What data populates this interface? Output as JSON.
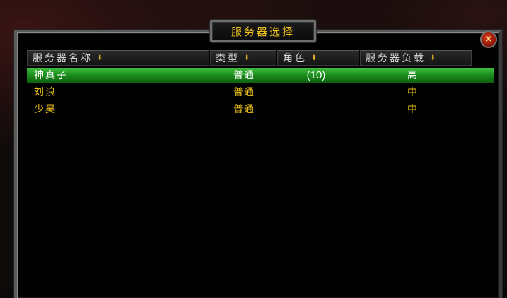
{
  "dialog": {
    "title": "服务器选择",
    "close_label": "✕"
  },
  "columns": [
    {
      "label": "服务器名称",
      "sort_icon": "sort-down-arrow-icon"
    },
    {
      "label": "类型",
      "sort_icon": "sort-down-arrow-icon"
    },
    {
      "label": "角色",
      "sort_icon": "sort-down-arrow-icon"
    },
    {
      "label": "服务器负载",
      "sort_icon": "sort-down-arrow-icon"
    }
  ],
  "servers": [
    {
      "name": "神真子",
      "type": "普通",
      "characters": "(10)",
      "load": "高",
      "selected": true
    },
    {
      "name": "刘浪",
      "type": "普通",
      "characters": "",
      "load": "中",
      "selected": false
    },
    {
      "name": "少昊",
      "type": "普通",
      "characters": "",
      "load": "中",
      "selected": false
    }
  ],
  "colors": {
    "accent_gold": "#f0c419",
    "selected_green": "#1a8a1a",
    "close_red": "#b0200c"
  }
}
